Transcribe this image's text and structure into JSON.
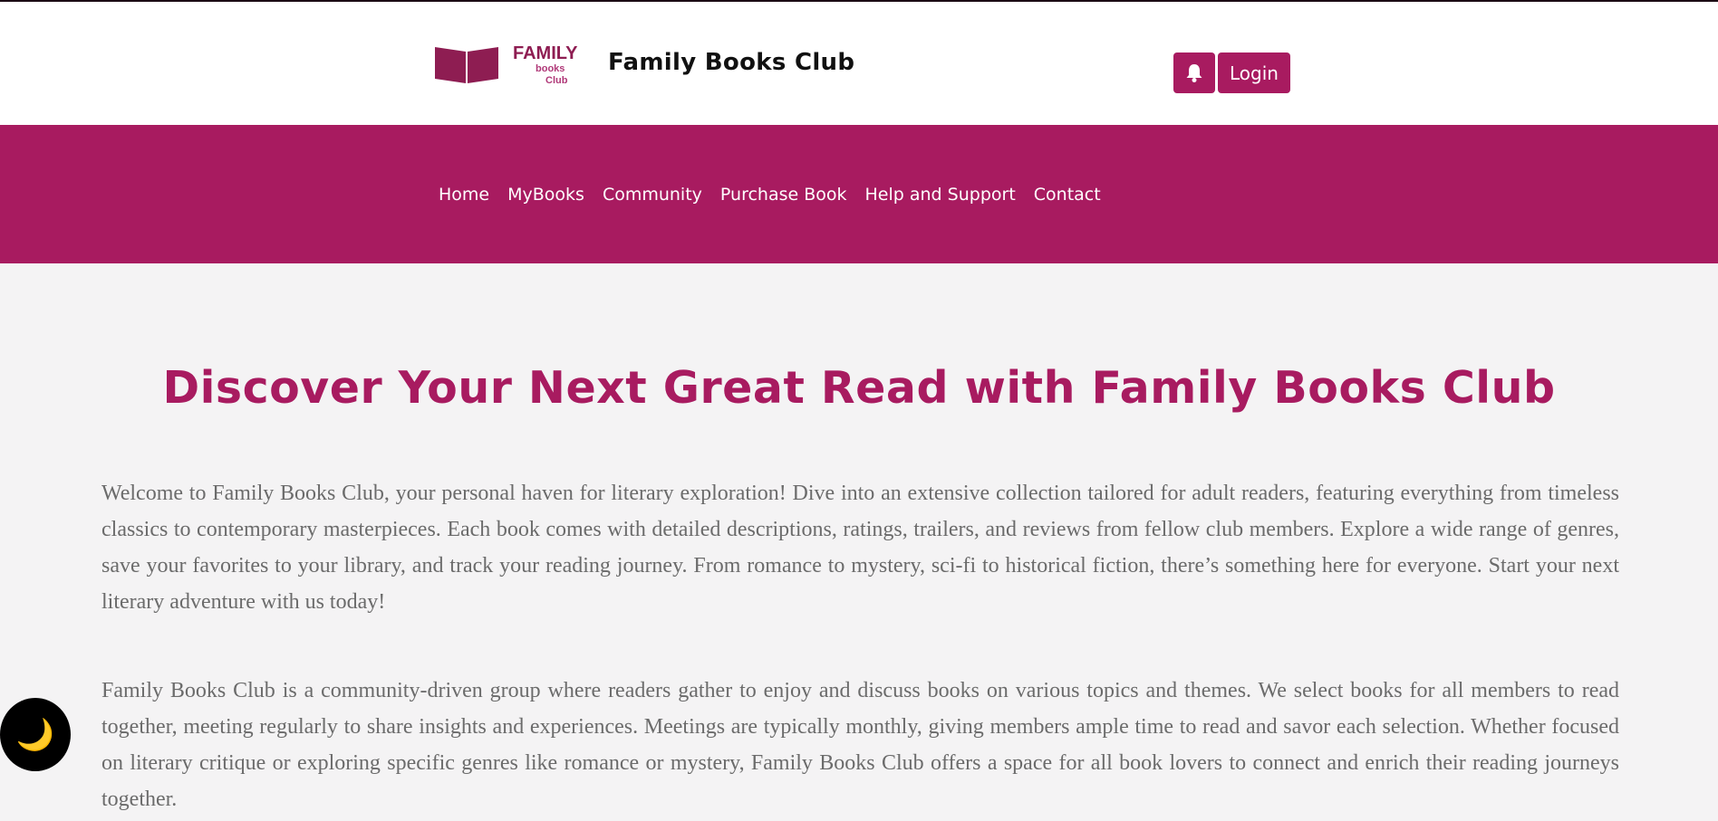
{
  "header": {
    "logo_text": {
      "line1": "FAMILY",
      "line2": "books",
      "line3": "Club"
    },
    "brand_name": "Family Books Club",
    "notification_icon": "bell-icon",
    "login_label": "Login"
  },
  "nav": {
    "items": [
      {
        "label": "Home"
      },
      {
        "label": "MyBooks"
      },
      {
        "label": "Community"
      },
      {
        "label": "Purchase Book"
      },
      {
        "label": "Help and Support"
      },
      {
        "label": "Contact"
      }
    ]
  },
  "main": {
    "title": "Discover Your Next Great Read with Family Books Club",
    "paragraphs": [
      "Welcome to Family Books Club, your personal haven for literary exploration! Dive into an extensive collection tailored for adult readers, featuring everything from timeless classics to contemporary masterpieces. Each book comes with detailed descriptions, ratings, trailers, and reviews from fellow club members. Explore a wide range of genres, save your favorites to your library, and track your reading journey. From romance to mystery, sci-fi to historical fiction, there’s something here for everyone. Start your next literary adventure with us today!",
      "Family Books Club is a community-driven group where readers gather to enjoy and discuss books on various topics and themes. We select books for all members to read together, meeting regularly to share insights and experiences. Meetings are typically monthly, giving members ample time to read and savor each selection. Whether focused on literary critique or exploring specific genres like romance or mystery, Family Books Club offers a space for all book lovers to connect and enrich their reading journeys together."
    ]
  },
  "theme_toggle": {
    "icon": "moon-icon",
    "glyph": "🌙"
  },
  "colors": {
    "brand": "#a81b60",
    "background": "#f4f3f4",
    "text": "#6b6b6b"
  }
}
